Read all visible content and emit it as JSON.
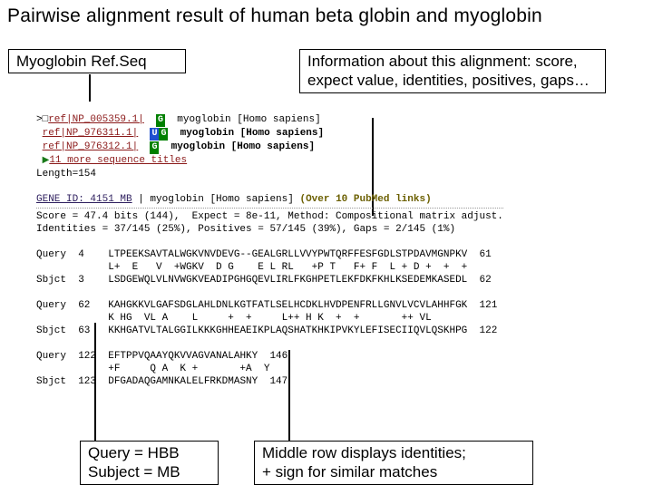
{
  "title": "Pairwise alignment result of human beta globin and myoglobin",
  "box_left": "Myoglobin Ref.Seq",
  "box_right": "Information about this alignment: score, expect value, identities, positives, gaps…",
  "box_bottom_left_l1": "Query = HBB",
  "box_bottom_left_l2": "Subject = MB",
  "box_bottom_right_l1": "Middle row displays identities;",
  "box_bottom_right_l2": "+ sign for similar matches",
  "seqs": {
    "ref1_id": "ref|NP_005359.1|",
    "ref1_desc": "myoglobin [Homo sapiens]",
    "ref2_id": "ref|NP_976311.1|",
    "ref2_desc": "myoglobin [Homo sapiens]",
    "ref3_id": "ref|NP_976312.1|",
    "ref3_desc": "myoglobin [Homo sapiens]",
    "more": "11 more sequence titles",
    "length": "Length=154"
  },
  "gene_line_lead": "GENE ID: 4151 MB",
  "gene_line_desc": " | myoglobin [Homo sapiens] ",
  "gene_line_links": "(Over 10 PubMed links)",
  "stats_l1": "Score = 47.4 bits (144),  Expect = 8e-11, Method: Compositional matrix adjust.",
  "stats_l2": "Identities = 37/145 (25%), Positives = 57/145 (39%), Gaps = 2/145 (1%)",
  "aln": {
    "q1_lbl": "Query  4    ",
    "q1_seq": "LTPEEKSAVTALWGKVNVDEVG--GEALGRLLVVYPWTQRFFESFGDLSTPDAVMGNPKV",
    "q1_end": "  61",
    "m1": "            L+  E   V  +WGKV  D G    E L RL   +P T   F+ F  L + D +  +  +",
    "s1_lbl": "Sbjct  3    ",
    "s1_seq": "LSDGEWQLVLNVWGKVEADIPGHGQEVLIRLFKGHPETLEKFDKFKHLKSEDEMKASEDL",
    "s1_end": "  62",
    "q2_lbl": "Query  62   ",
    "q2_seq": "KAHGKKVLGAFSDGLAHLDNLKGTFATLSELHCDKLHVDPENFRLLGNVLVCVLAHHFGK",
    "q2_end": "  121",
    "m2": "            K HG  VL A    L     +  +     L++ H K  +  +       ++ VL     ",
    "s2_lbl": "Sbjct  63   ",
    "s2_seq": "KKHGATVLTALGGILKKKGHHEAEIKPLAQSHATKHKIPVKYLEFISECIIQVLQSKHPG",
    "s2_end": "  122",
    "q3_lbl": "Query  122  ",
    "q3_seq": "EFTPPVQAAYQKVVAGVANALAHKY",
    "q3_end": "  146",
    "m3": "            +F     Q A  K +       +A  Y",
    "s3_lbl": "Sbjct  123  ",
    "s3_seq": "DFGADAQGAMNKALELFRKDMASNY",
    "s3_end": "  147"
  }
}
